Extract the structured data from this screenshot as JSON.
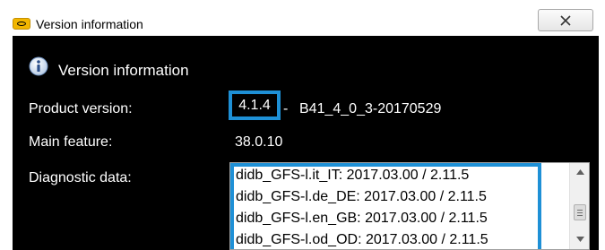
{
  "window": {
    "title": "Version information"
  },
  "dialog": {
    "heading": "Version information",
    "product_version_label": "Product version:",
    "product_version": "4.1.4",
    "separator": "-",
    "build": "B41_4_0_3-20170529",
    "main_feature_label": "Main feature:",
    "main_feature": "38.0.10",
    "diagnostic_label": "Diagnostic data:",
    "diagnostic_items": [
      "didb_GFS-l.it_IT: 2017.03.00 / 2.11.5",
      "didb_GFS-l.de_DE: 2017.03.00 / 2.11.5",
      "didb_GFS-l.en_GB: 2017.03.00 / 2.11.5",
      "didb_GFS-l.od_OD: 2017.03.00 / 2.11.5"
    ]
  },
  "colors": {
    "highlight": "#1e90d6",
    "background": "#000000",
    "app_icon": "#f2b600"
  },
  "icons": {
    "app": "app-logo-icon",
    "info": "info-icon",
    "close": "close-icon",
    "scroll_up": "scroll-up-arrow-icon",
    "scroll_down": "scroll-down-arrow-icon"
  }
}
